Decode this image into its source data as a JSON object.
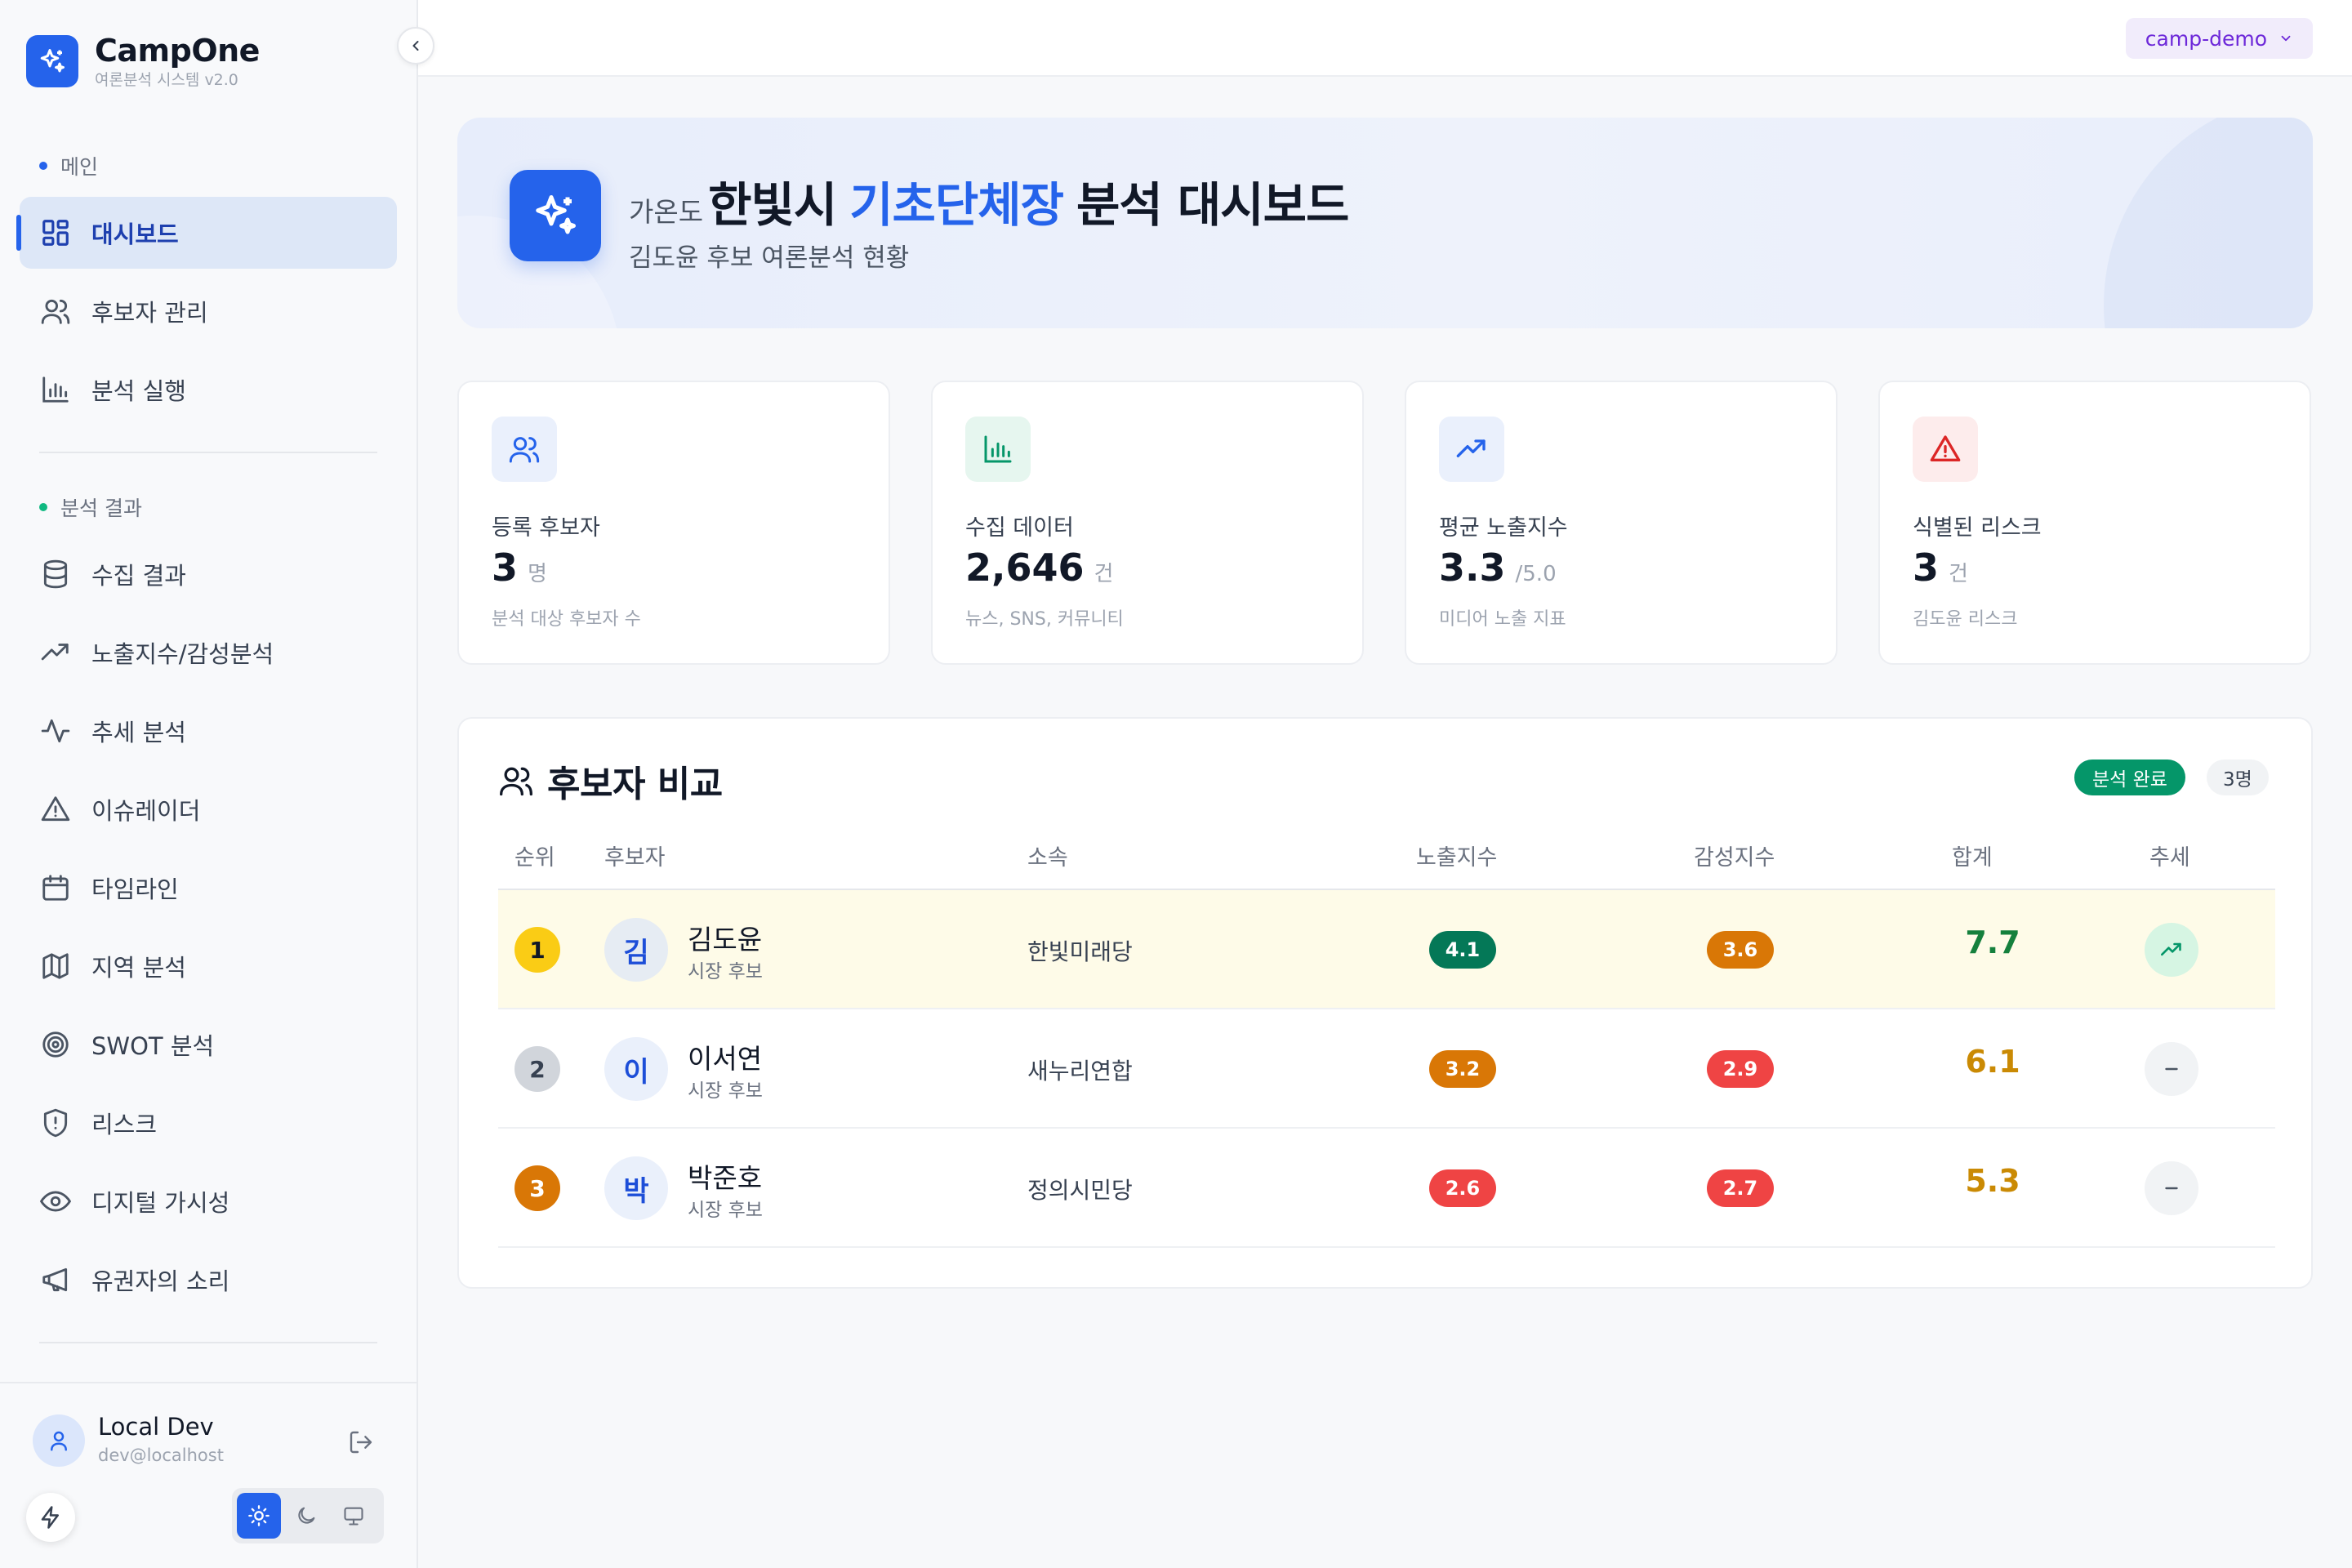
{
  "app": {
    "name": "CampOne",
    "subtitle": "여론분석 시스템 v2.0"
  },
  "sidebar": {
    "sections": [
      {
        "label": "메인",
        "color": "#2563eb"
      },
      {
        "label": "분석 결과",
        "color": "#10b981"
      }
    ],
    "items": [
      {
        "label": "대시보드",
        "icon": "dashboard-icon",
        "active": true
      },
      {
        "label": "후보자 관리",
        "icon": "users-icon"
      },
      {
        "label": "분석 실행",
        "icon": "bar-chart-icon"
      },
      {
        "label": "수집 결과",
        "icon": "database-icon"
      },
      {
        "label": "노출지수/감성분석",
        "icon": "trending-up-icon"
      },
      {
        "label": "추세 분석",
        "icon": "activity-icon"
      },
      {
        "label": "이슈레이더",
        "icon": "alert-triangle-icon"
      },
      {
        "label": "타임라인",
        "icon": "calendar-icon"
      },
      {
        "label": "지역 분석",
        "icon": "map-icon"
      },
      {
        "label": "SWOT 분석",
        "icon": "target-icon"
      },
      {
        "label": "리스크",
        "icon": "shield-alert-icon"
      },
      {
        "label": "디지털 가시성",
        "icon": "eye-icon"
      },
      {
        "label": "유권자의 소리",
        "icon": "megaphone-icon"
      }
    ]
  },
  "user": {
    "name": "Local Dev",
    "email": "dev@localhost"
  },
  "header": {
    "workspace": "camp-demo"
  },
  "hero": {
    "prefix": "가온도",
    "city": "한빛시",
    "accent": "기초단체장",
    "rest": "분석 대시보드",
    "subtitle": "김도윤 후보 여론분석 현황"
  },
  "stats": [
    {
      "label": "등록 후보자",
      "value": "3",
      "unit": "명",
      "desc": "분석 대상 후보자 수",
      "icon": "users-icon",
      "color": "#2563eb",
      "bg": "#eaf0fc"
    },
    {
      "label": "수집 데이터",
      "value": "2,646",
      "unit": "건",
      "desc": "뉴스, SNS, 커뮤니티",
      "icon": "bar-chart-icon",
      "color": "#059669",
      "bg": "#e6f6ef"
    },
    {
      "label": "평균 노출지수",
      "value": "3.3",
      "unit": "/5.0",
      "desc": "미디어 노출 지표",
      "icon": "trending-up-icon",
      "color": "#2563eb",
      "bg": "#eaf0fc"
    },
    {
      "label": "식별된 리스크",
      "value": "3",
      "unit": "건",
      "desc": "김도윤 리스크",
      "icon": "alert-triangle-icon",
      "color": "#dc2626",
      "bg": "#fdecec"
    }
  ],
  "comparison": {
    "title": "후보자 비교",
    "status": "분석 완료",
    "count": "3명",
    "columns": {
      "rank": "순위",
      "candidate": "후보자",
      "party": "소속",
      "exposure": "노출지수",
      "sentiment": "감성지수",
      "total": "합계",
      "trend": "추세"
    },
    "rows": [
      {
        "rank": "1",
        "initial": "김",
        "name": "김도윤",
        "role": "시장 후보",
        "party": "한빛미래당",
        "exposure": "4.1",
        "sentiment": "3.6",
        "total": "7.7",
        "trend": "up"
      },
      {
        "rank": "2",
        "initial": "이",
        "name": "이서연",
        "role": "시장 후보",
        "party": "새누리연합",
        "exposure": "3.2",
        "sentiment": "2.9",
        "total": "6.1",
        "trend": "flat"
      },
      {
        "rank": "3",
        "initial": "박",
        "name": "박준호",
        "role": "시장 후보",
        "party": "정의시민당",
        "exposure": "2.6",
        "sentiment": "2.7",
        "total": "5.3",
        "trend": "flat"
      }
    ]
  },
  "colors": {
    "primary": "#2563eb",
    "success": "#059669",
    "high": "#047857",
    "mid": "#d97706",
    "low": "#ef4444",
    "gold": "#facc15",
    "silver": "#d1d5db",
    "bronze": "#d97706"
  }
}
